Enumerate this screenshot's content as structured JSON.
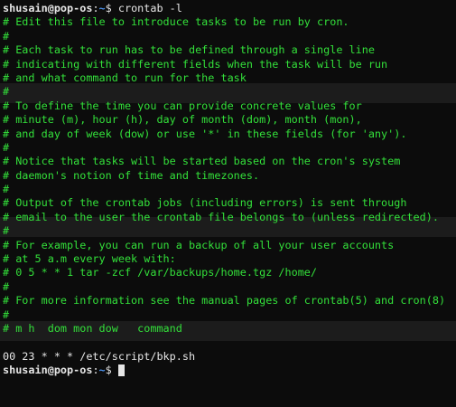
{
  "prompt": {
    "user_host": "shusain@pop-os",
    "separator": ":",
    "path": "~",
    "symbol": "$"
  },
  "command": " crontab -l",
  "comments": [
    "# Edit this file to introduce tasks to be run by cron.",
    "#",
    "# Each task to run has to be defined through a single line",
    "# indicating with different fields when the task will be run",
    "# and what command to run for the task",
    "#",
    "# To define the time you can provide concrete values for",
    "# minute (m), hour (h), day of month (dom), month (mon),",
    "# and day of week (dow) or use '*' in these fields (for 'any').",
    "#",
    "# Notice that tasks will be started based on the cron's system",
    "# daemon's notion of time and timezones.",
    "#",
    "# Output of the crontab jobs (including errors) is sent through",
    "# email to the user the crontab file belongs to (unless redirected).",
    "#",
    "# For example, you can run a backup of all your user accounts",
    "# at 5 a.m every week with:",
    "# 0 5 * * 1 tar -zcf /var/backups/home.tgz /home/",
    "#",
    "# For more information see the manual pages of crontab(5) and cron(8)",
    "#",
    "# m h  dom mon dow   command"
  ],
  "cron_entry": "00 23 * * * /etc/script/bkp.sh",
  "colors": {
    "comment": "#33e03a",
    "path": "#4a8fe8",
    "text": "#e6e6e6",
    "background": "#0c0c0c"
  }
}
